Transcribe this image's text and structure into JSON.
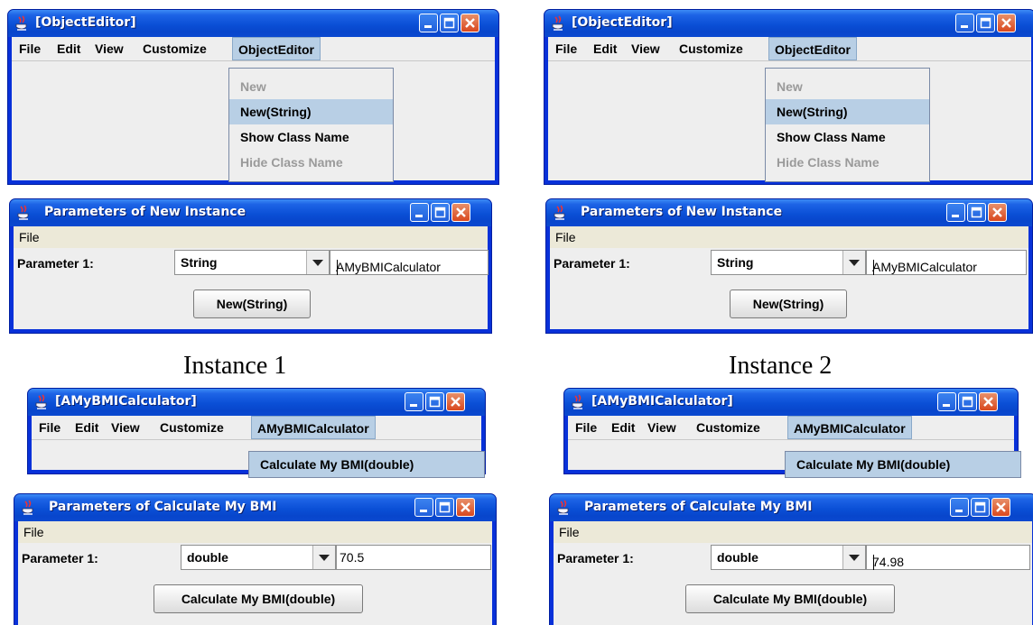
{
  "caption_left": "Instance 1",
  "caption_right": "Instance 2",
  "menu_labels": {
    "file": "File",
    "edit": "Edit",
    "view": "View",
    "customize": "Customize"
  },
  "object_editor_window": {
    "title": "[ObjectEditor]",
    "menu_selected": "ObjectEditor",
    "popup_items": [
      "New",
      "New(String)",
      "Show Class Name",
      "Hide Class Name",
      "Show Class Name"
    ]
  },
  "new_instance_dialog": {
    "title": "Parameters of New Instance",
    "file_menu": "File",
    "param_label": "Parameter 1:",
    "type_value": "String",
    "arg_value": "AMyBMICalculator",
    "button": "New(String)"
  },
  "calc_window": {
    "title": "[AMyBMICalculator]",
    "menu_selected": "AMyBMICalculator",
    "popup_item": "Calculate My BMI(double)"
  },
  "calc_dialog": {
    "title": "Parameters of Calculate My BMI",
    "file_menu": "File",
    "param_label": "Parameter 1:",
    "type_value": "double",
    "button": "Calculate My BMI(double)"
  },
  "instance_values": {
    "left_arg": "70.5",
    "right_arg": "74.98"
  },
  "colors": {
    "title_blue": "#0a4fd6",
    "menu_highlight": "#b8cfe5",
    "close_red": "#d9481e"
  }
}
